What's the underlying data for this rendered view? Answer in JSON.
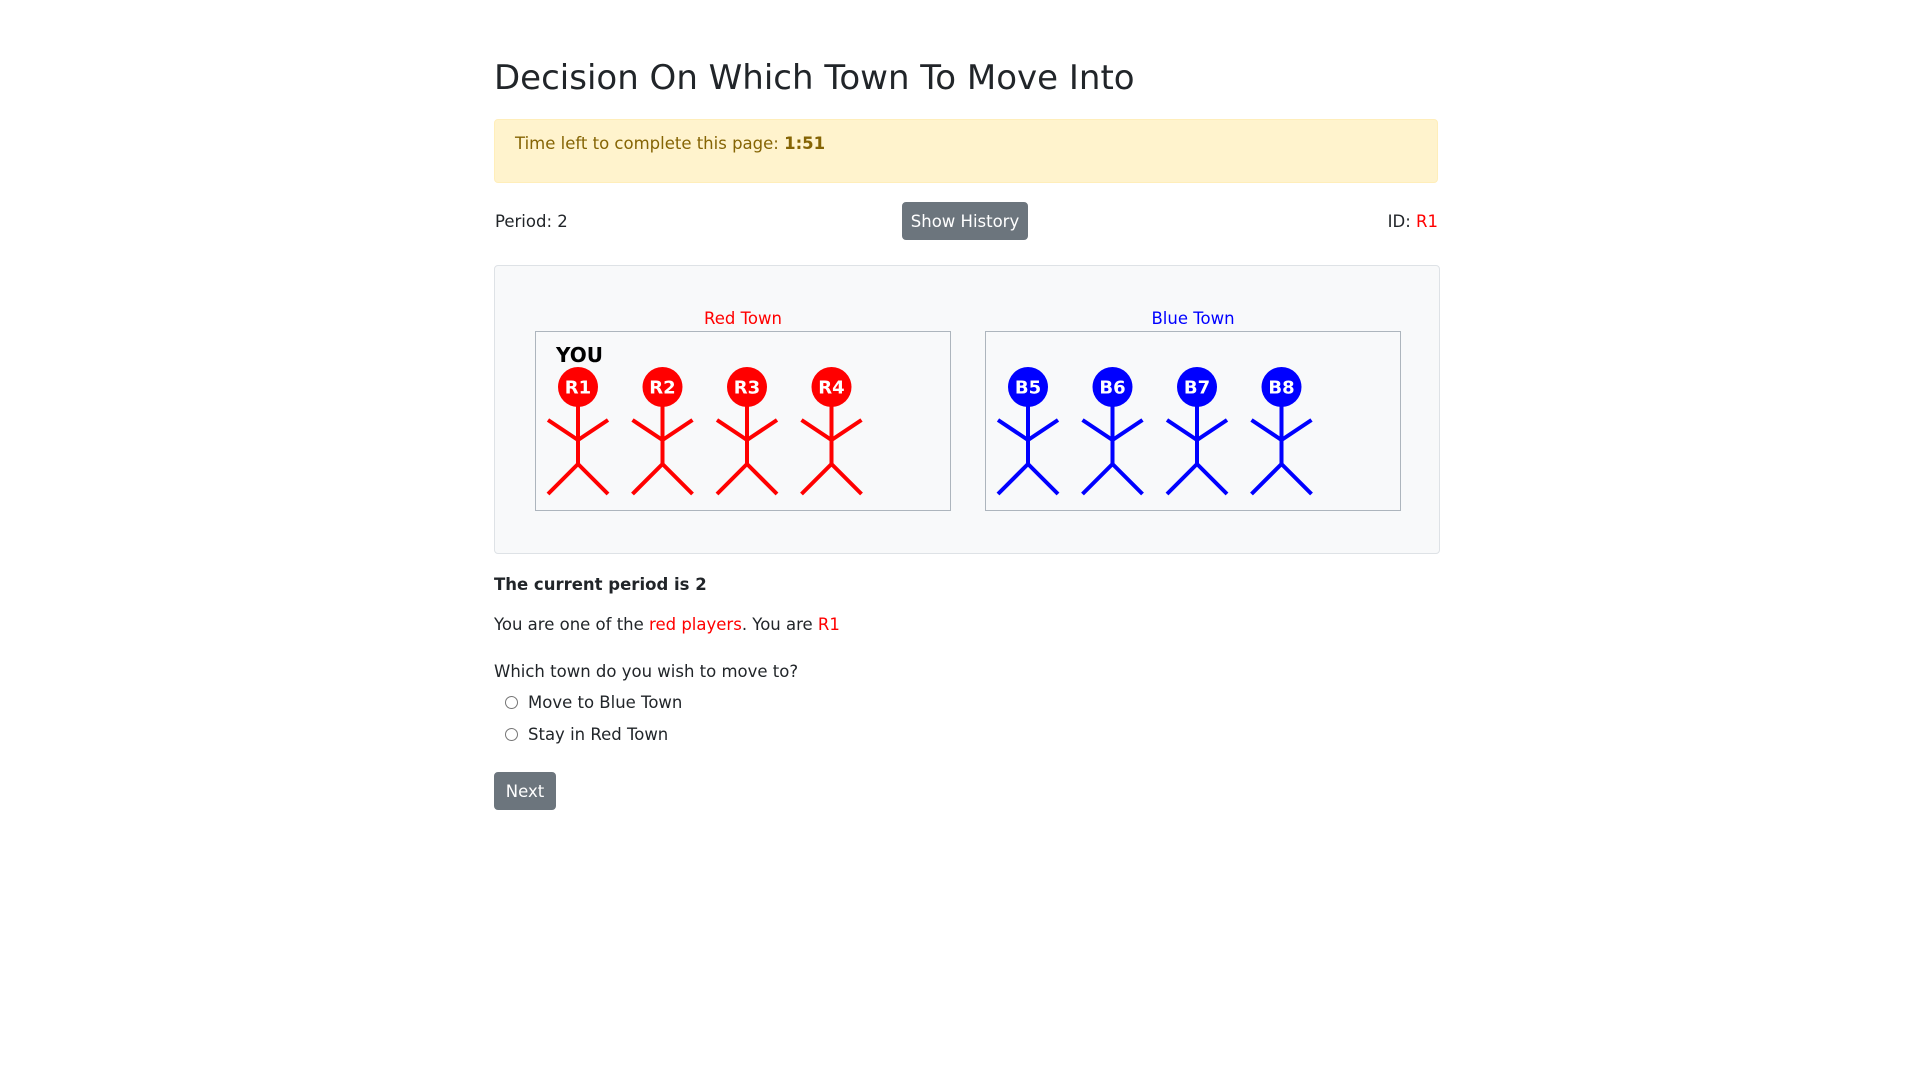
{
  "page_title": "Decision On Which Town To Move Into",
  "timer": {
    "prefix": "Time left to complete this page:",
    "value": "1:51"
  },
  "info": {
    "period_label": "Period: 2",
    "show_history_label": "Show History",
    "id_prefix": "ID:",
    "id_value": "R1"
  },
  "towns": {
    "red": {
      "title": "Red Town",
      "you_label": "YOU",
      "players": [
        "R1",
        "R2",
        "R3",
        "R4"
      ],
      "color": "#ff0000"
    },
    "blue": {
      "title": "Blue Town",
      "players": [
        "B5",
        "B6",
        "B7",
        "B8"
      ],
      "color": "#0000ff"
    }
  },
  "status": {
    "current_period": "The current period is 2",
    "role_prefix": "You are one of the",
    "role_highlight": "red players",
    "role_middle": ". You are",
    "role_id": "R1"
  },
  "form": {
    "question": "Which town do you wish to move to?",
    "options": [
      "Move to Blue Town",
      "Stay in Red Town"
    ],
    "next_label": "Next"
  }
}
